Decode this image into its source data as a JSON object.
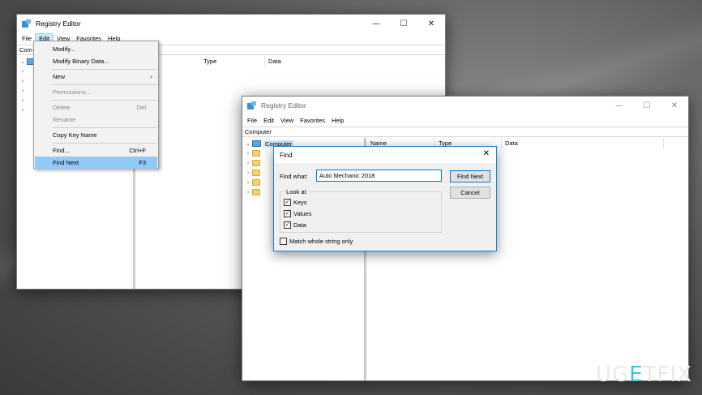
{
  "windows": {
    "back": {
      "title": "Registry Editor",
      "menu": [
        "File",
        "Edit",
        "View",
        "Favorites",
        "Help"
      ],
      "address": "Com",
      "columns": [
        "Type",
        "Data"
      ]
    },
    "front": {
      "title": "Registry Editor",
      "menu": [
        "File",
        "Edit",
        "View",
        "Favorites",
        "Help"
      ],
      "address": "Computer",
      "tree_root": "Computer",
      "columns": [
        "Name",
        "Type",
        "Data"
      ]
    }
  },
  "edit_menu": {
    "items": [
      {
        "label": "Modify...",
        "shortcut": "",
        "disabled": false
      },
      {
        "label": "Modify Binary Data...",
        "shortcut": "",
        "disabled": false
      },
      {
        "label": "New",
        "shortcut": "",
        "disabled": false,
        "submenu": true
      },
      {
        "label": "Permissions...",
        "shortcut": "",
        "disabled": true
      },
      {
        "label": "Delete",
        "shortcut": "Del",
        "disabled": true
      },
      {
        "label": "Rename",
        "shortcut": "",
        "disabled": true
      },
      {
        "label": "Copy Key Name",
        "shortcut": "",
        "disabled": false
      },
      {
        "label": "Find...",
        "shortcut": "Ctrl+F",
        "disabled": false
      },
      {
        "label": "Find Next",
        "shortcut": "F3",
        "disabled": false,
        "highlighted": true
      }
    ]
  },
  "find_dialog": {
    "title": "Find",
    "find_what_label": "Find what:",
    "find_what_value": "Auto Mechanic 2018",
    "find_next_label": "Find Next",
    "cancel_label": "Cancel",
    "look_at_label": "Look at",
    "keys_label": "Keys",
    "keys_checked": true,
    "values_label": "Values",
    "values_checked": true,
    "data_label": "Data",
    "data_checked": true,
    "match_label": "Match whole string only",
    "match_checked": false
  },
  "watermark": {
    "left": "UG",
    "accent": "E",
    "right": "TFIX"
  },
  "colors": {
    "accent": "#0078d7",
    "menu_highlight": "#91c9f7",
    "folder": "#f3d16b"
  },
  "glyphs": {
    "minimize": "—",
    "maximize": "☐",
    "close": "✕",
    "chevron_right": "›",
    "chevron_down": "⌄",
    "check": "✓",
    "submenu_arrow": "›"
  }
}
